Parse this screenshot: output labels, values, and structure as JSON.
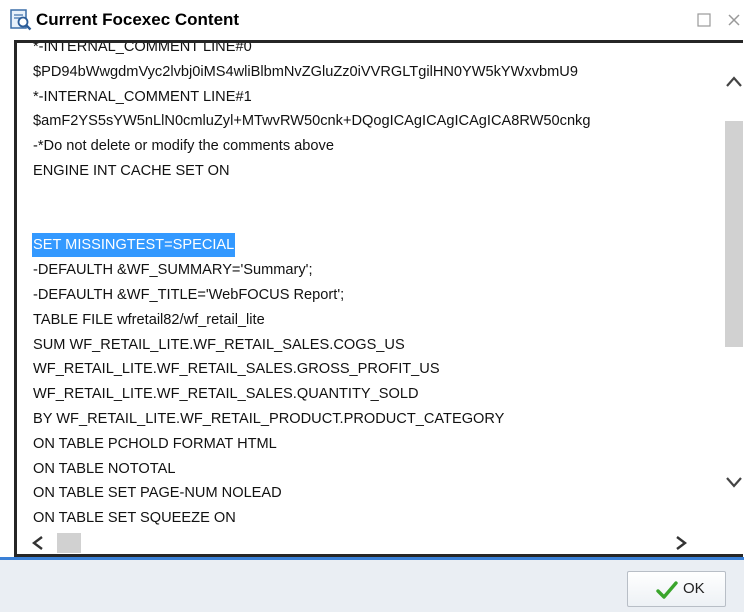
{
  "window": {
    "title": "Current Focexec Content",
    "icons": {
      "app": "document-search-icon",
      "maximize": "maximize-icon",
      "close": "close-icon"
    }
  },
  "editor": {
    "lines": [
      "*-INTERNAL_COMMENT LINE#0",
      "$PD94bWwgdmVyc2lvbj0iMS4wliBlbmNvZGluZz0iVVRGLTgilHN0YW5kYWxvbmU9",
      "*-INTERNAL_COMMENT LINE#1",
      "$amF2YS5sYW5nLlN0cmluZyl+MTwvRW50cnk+DQogICAgICAgICAgICA8RW50cnkg",
      "-*Do not delete or modify the comments above",
      "ENGINE INT CACHE SET ON",
      "",
      "",
      "SET MISSINGTEST=SPECIAL",
      "-DEFAULTH &WF_SUMMARY='Summary';",
      "-DEFAULTH &WF_TITLE='WebFOCUS Report';",
      "TABLE FILE wfretail82/wf_retail_lite",
      "SUM WF_RETAIL_LITE.WF_RETAIL_SALES.COGS_US",
      "WF_RETAIL_LITE.WF_RETAIL_SALES.GROSS_PROFIT_US",
      "WF_RETAIL_LITE.WF_RETAIL_SALES.QUANTITY_SOLD",
      "BY WF_RETAIL_LITE.WF_RETAIL_PRODUCT.PRODUCT_CATEGORY",
      "ON TABLE PCHOLD FORMAT HTML",
      "ON TABLE NOTOTAL",
      "ON TABLE SET PAGE-NUM NOLEAD",
      "ON TABLE SET SQUEEZE ON"
    ],
    "selected_line": "SET MISSINGTEST=SPECIAL",
    "selection_color": "#3399ff"
  },
  "footer": {
    "ok_label": "OK",
    "ok_icon": "checkmark-icon",
    "accent_color": "#3a80d6"
  }
}
